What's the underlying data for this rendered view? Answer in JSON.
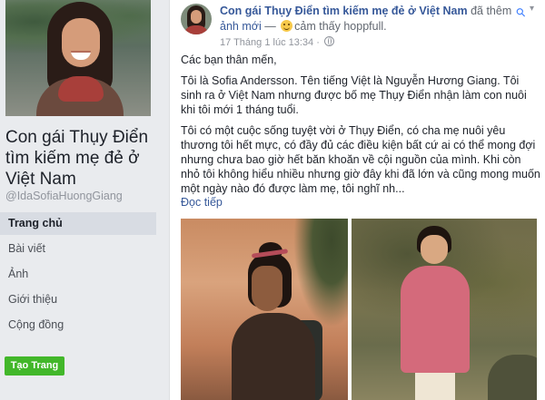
{
  "left": {
    "page_title": "Con gái Thụy Điển tìm kiếm mẹ đẻ ở Việt Nam",
    "username": "@IdaSofiaHuongGiang",
    "nav_items": [
      {
        "label": "Trang chủ",
        "active": true
      },
      {
        "label": "Bài viết"
      },
      {
        "label": "Ảnh"
      },
      {
        "label": "Giới thiệu"
      },
      {
        "label": "Cộng đồng"
      }
    ],
    "create_page_label": "Tạo Trang"
  },
  "post": {
    "author": "Con gái Thụy Điển tìm kiếm mẹ đẻ ở Việt Nam",
    "action_text": " đã thêm ",
    "action_link": "ảnh mới",
    "feeling_prefix": " — ",
    "feeling_text": "cảm thấy hoppfull.",
    "timestamp": "17 Tháng 1 lúc 13:34 · ",
    "paragraphs": [
      "Các bạn thân mến,",
      "Tôi là Sofia Andersson. Tên tiếng Việt là Nguyễn Hương Giang. Tôi sinh ra ở Việt Nam nhưng được bố mẹ Thụy Điển nhận làm con nuôi khi tôi mới 1 tháng tuổi.",
      "Tôi có một cuộc sống tuyệt vời ở Thụy Điển, có cha mẹ nuôi yêu thương tôi hết mực, có đầy đủ các điều kiện bất cứ ai có thể mong đợi nhưng chưa bao giờ hết băn khoăn về cội nguồn của mình. Khi còn nhỏ tôi không hiểu nhiều nhưng giờ đây khi đã lớn và cũng mong muốn một ngày nào đó được làm mẹ, tôi nghĩ nh..."
    ],
    "see_more": "Đọc tiếp"
  },
  "icons": {
    "pin": "pin-icon",
    "globe": "globe-icon",
    "emoji": "smile-emoji-icon",
    "caret": "chevron-down-icon"
  },
  "colors": {
    "link": "#365899",
    "create_button": "#42b72a",
    "background": "#e9ebee"
  }
}
